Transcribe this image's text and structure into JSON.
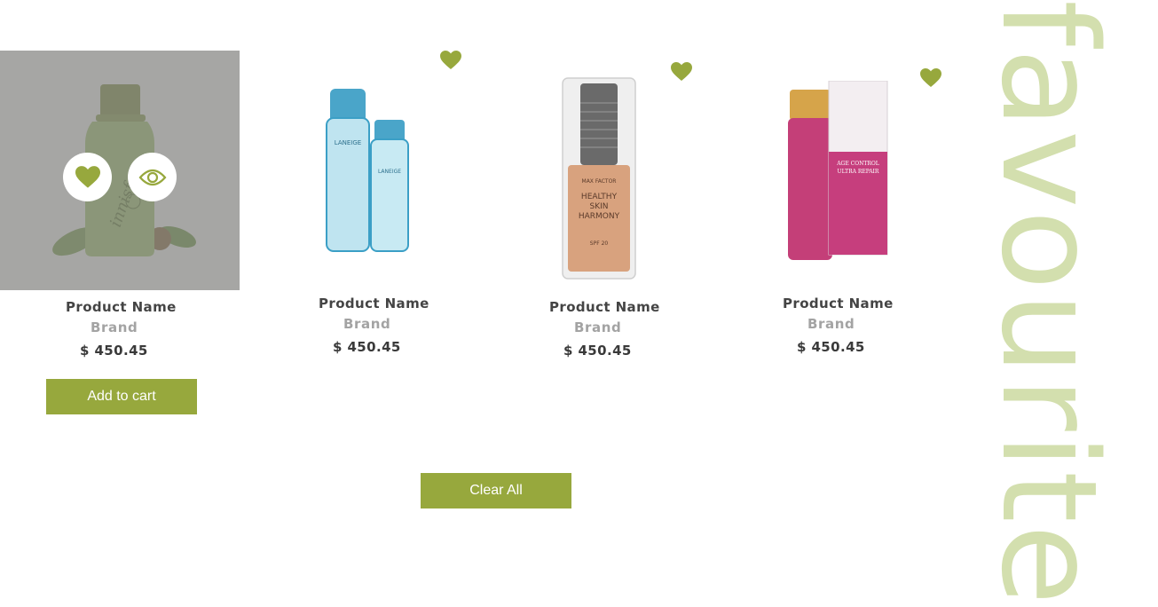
{
  "page": {
    "title": "favourite",
    "accent_color": "#97a83d",
    "title_color": "#d3dfae"
  },
  "products": [
    {
      "name": "Product Name",
      "brand": "Brand",
      "price": "$ 450.45",
      "image": "innisfree green tea serum bottle",
      "hovered": true,
      "add_to_cart_label": "Add to cart",
      "actions": [
        "heart-icon",
        "eye-icon"
      ]
    },
    {
      "name": "Product Name",
      "brand": "Brand",
      "price": "$ 450.45",
      "image": "laneige skin refiner and emulsion bottles",
      "hovered": false
    },
    {
      "name": "Product Name",
      "brand": "Brand",
      "price": "$ 450.45",
      "image": "max factor healthy skin harmony foundation",
      "hovered": false
    },
    {
      "name": "Product Name",
      "brand": "Brand",
      "price": "$ 450.45",
      "image": "pink age control ultra repair bottle and box",
      "hovered": false
    }
  ],
  "clear_all_label": "Clear All"
}
